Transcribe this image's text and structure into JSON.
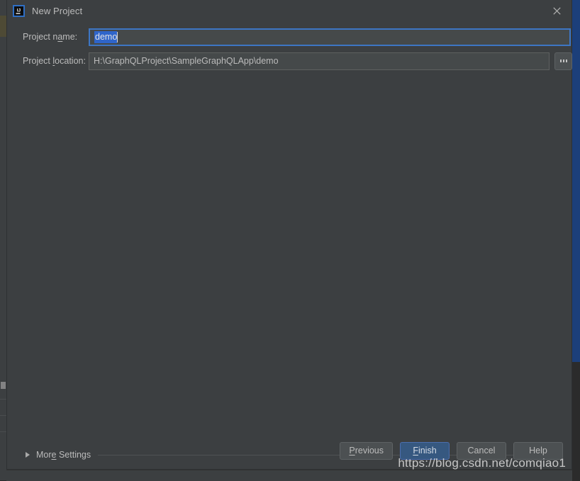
{
  "window": {
    "title": "New Project",
    "app_icon": "intellij-idea-icon",
    "close_icon": "close-icon"
  },
  "form": {
    "project_name": {
      "label_before": "Project n",
      "label_mnemonic": "a",
      "label_after": "me:",
      "value": "demo",
      "selected": true
    },
    "project_location": {
      "label_before": "Project ",
      "label_mnemonic": "l",
      "label_after": "ocation:",
      "value": "H:\\GraphQLProject\\SampleGraphQLApp\\demo"
    },
    "browse_button": "..."
  },
  "more_settings": {
    "label_before": "Mor",
    "label_mnemonic": "e",
    "label_after": " Settings",
    "expanded": false,
    "chevron_icon": "triangle-right-icon"
  },
  "buttons": [
    {
      "name": "previous",
      "before": "",
      "mnemonic": "P",
      "after": "revious",
      "primary": false
    },
    {
      "name": "finish",
      "before": "",
      "mnemonic": "F",
      "after": "inish",
      "primary": true
    },
    {
      "name": "cancel",
      "before": "Cancel",
      "mnemonic": "",
      "after": "",
      "primary": false
    },
    {
      "name": "help",
      "before": "Help",
      "mnemonic": "",
      "after": "",
      "primary": false
    }
  ],
  "watermark": "https://blog.csdn.net/comqiao1",
  "colors": {
    "dialog_bg": "#3c3f41",
    "input_bg": "#45494a",
    "focus_border": "#3d76c4",
    "selection": "#2f65ca",
    "primary_button": "#365880",
    "text": "#bbbbbb",
    "editor_blue": "#1c3f7a"
  }
}
